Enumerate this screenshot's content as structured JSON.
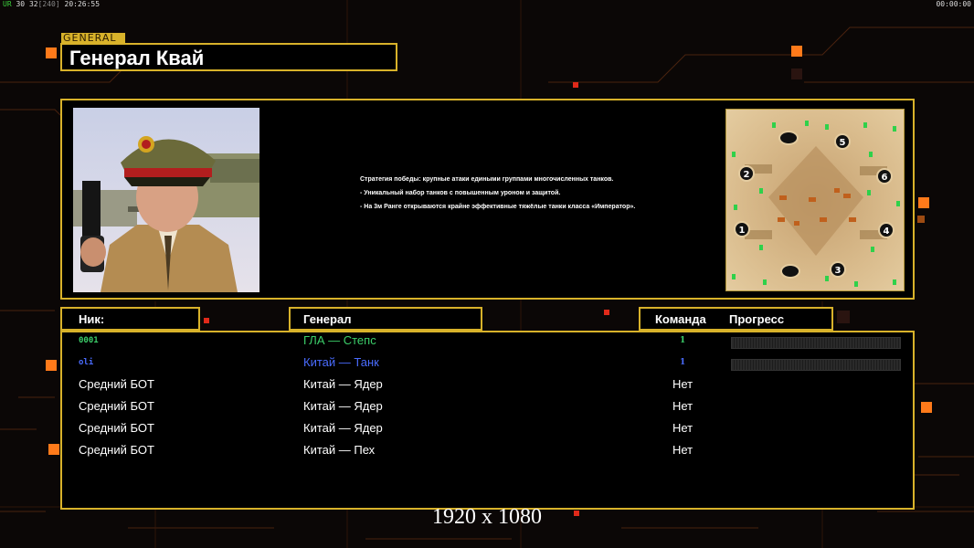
{
  "hud": {
    "fps_label": "UR",
    "fps_value": "30",
    "fps_rate": "32",
    "fps_bracket": "[240]",
    "clock": "20:26:55",
    "timer": "00:00:00"
  },
  "header": {
    "tag": "GENERAL",
    "general_name": "Генерал Квай"
  },
  "general_info": {
    "strategy": "Стратегия победы: крупные атаки едиными группами многочисленных танков.",
    "feature_1": "- Уникальный набор танков с повышенным уроном и защитой.",
    "feature_2": "- На 3м Ранге открываются крайне эффективные тяжёлые танки класса «Император»."
  },
  "minimap": {
    "start_positions": [
      "1",
      "2",
      "3",
      "4",
      "5",
      "6"
    ]
  },
  "columns": {
    "nick": "Ник:",
    "general": "Генерал",
    "team": "Команда",
    "progress": "Прогресс"
  },
  "players": [
    {
      "nick": "0001",
      "general": "ГЛА — Степс",
      "team": "1",
      "color": "#3ccf6a",
      "show_progress": true
    },
    {
      "nick": "oli",
      "general": "Китай — Танк",
      "team": "1",
      "color": "#4a6cff",
      "show_progress": true
    },
    {
      "nick": "Средний БОТ",
      "general": "Китай — Ядер",
      "team": "Нет",
      "color": "#ffffff",
      "show_progress": false
    },
    {
      "nick": "Средний БОТ",
      "general": "Китай — Ядер",
      "team": "Нет",
      "color": "#ffffff",
      "show_progress": false
    },
    {
      "nick": "Средний БОТ",
      "general": "Китай — Ядер",
      "team": "Нет",
      "color": "#ffffff",
      "show_progress": false
    },
    {
      "nick": "Средний БОТ",
      "general": "Китай — Пех",
      "team": "Нет",
      "color": "#ffffff",
      "show_progress": false
    }
  ],
  "resolution_overlay": "1920 x 1080",
  "colors": {
    "frame": "#d8b22a",
    "accent_orange": "#ff7a1a",
    "accent_red": "#e02a1a"
  }
}
